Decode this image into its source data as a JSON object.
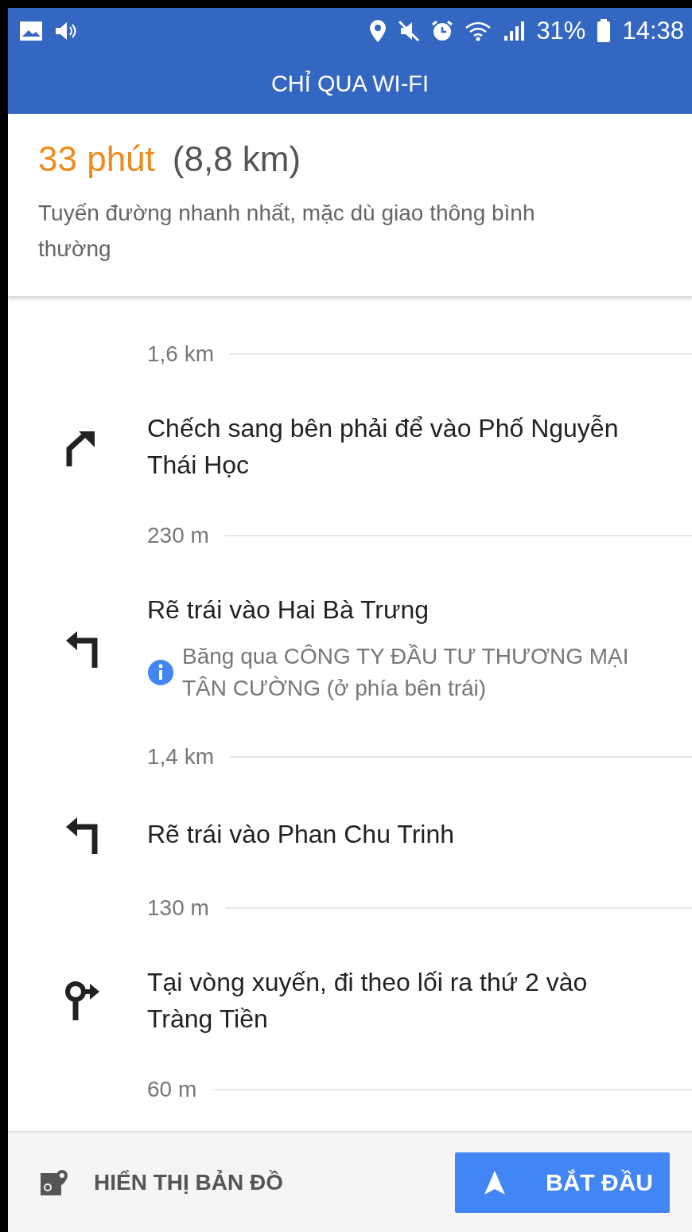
{
  "status_bar": {
    "battery": "31%",
    "time": "14:38"
  },
  "title_bar": {
    "title": "CHỈ QUA WI-FI"
  },
  "summary": {
    "duration": "33 phút",
    "distance": "(8,8 km)",
    "description": "Tuyến đường nhanh nhất, mặc dù giao thông bình thường"
  },
  "steps": [
    {
      "kind": "distance",
      "text": "1,6 km"
    },
    {
      "kind": "slight-right",
      "text": "Chếch sang bên phải để vào Phố Nguyễn Thái Học"
    },
    {
      "kind": "distance",
      "text": "230 m"
    },
    {
      "kind": "left",
      "text": "Rẽ trái vào Hai Bà Trưng",
      "note": "Băng qua CÔNG TY ĐẦU TƯ THƯƠNG MẠI TÂN CƯỜNG (ở phía bên trái)"
    },
    {
      "kind": "distance",
      "text": "1,4 km"
    },
    {
      "kind": "left",
      "text": "Rẽ trái vào Phan Chu Trinh"
    },
    {
      "kind": "distance",
      "text": "130 m"
    },
    {
      "kind": "roundabout",
      "text": "Tại vòng xuyến, đi theo lối ra thứ 2 vào Tràng Tiền"
    },
    {
      "kind": "distance",
      "text": "60 m"
    }
  ],
  "bottom_bar": {
    "map_button": "HIỂN THỊ BẢN ĐỒ",
    "start_button": "BẮT ĐẦU"
  }
}
